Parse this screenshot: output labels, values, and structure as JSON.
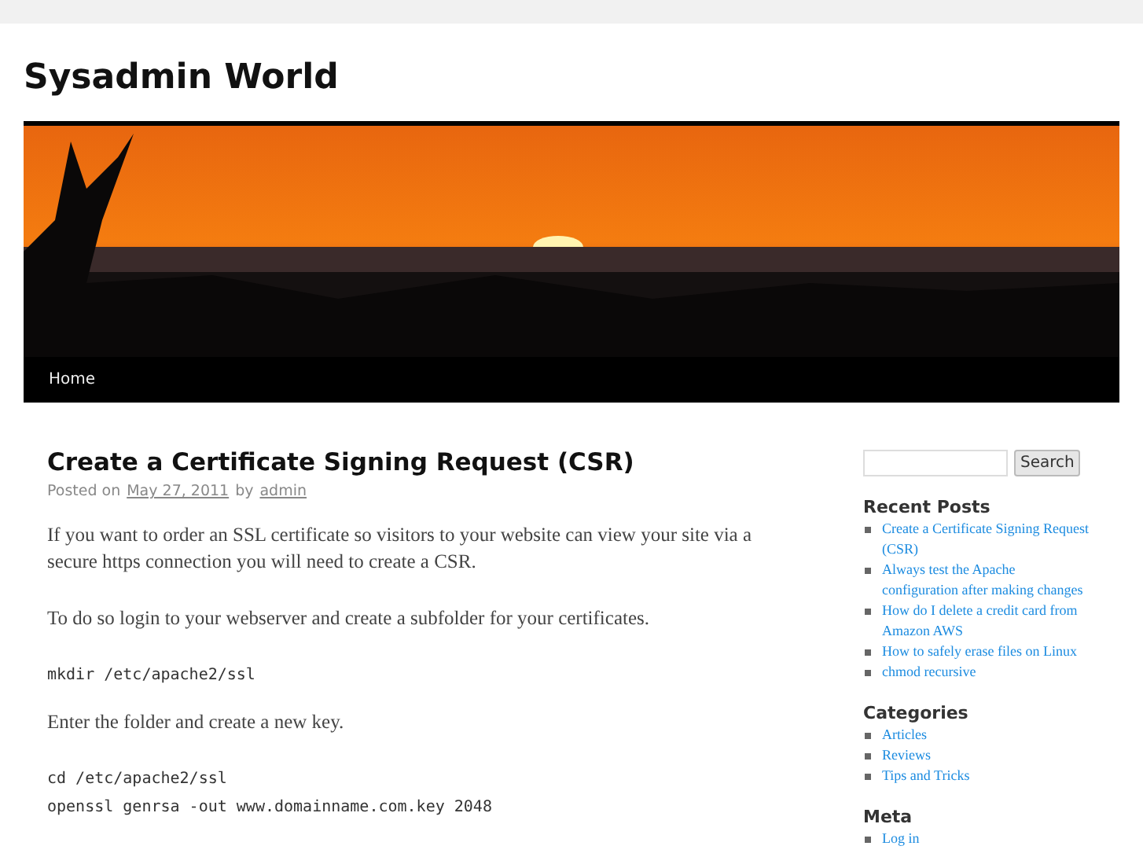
{
  "site": {
    "title": "Sysadmin World"
  },
  "nav": [
    {
      "label": "Home"
    }
  ],
  "post": {
    "title": "Create a Certificate Signing Request (CSR)",
    "meta": {
      "prefix": "Posted on",
      "date": "May 27, 2011",
      "by": "by",
      "author": "admin"
    },
    "blocks": [
      {
        "kind": "text",
        "lines": [
          "If you want to order an SSL certificate so visitors to your website can view your site via a secure https connection you will need to create a CSR."
        ]
      },
      {
        "kind": "text",
        "lines": [
          "To do so login to your webserver and create a subfolder for your certificates."
        ]
      },
      {
        "kind": "code",
        "lines": [
          "mkdir /etc/apache2/ssl"
        ]
      },
      {
        "kind": "text",
        "lines": [
          "Enter the folder and create a new key."
        ]
      },
      {
        "kind": "code",
        "lines": [
          "cd /etc/apache2/ssl",
          "openssl genrsa -out www.domainname.com.key 2048"
        ]
      }
    ]
  },
  "sidebar": {
    "search": {
      "button": "Search"
    },
    "widgets": [
      {
        "title": "Recent Posts",
        "items": [
          "Create a Certificate Signing Request (CSR)",
          "Always test the Apache configuration after making changes",
          "How do I delete a credit card from Amazon AWS",
          "How to safely erase files on Linux",
          "chmod recursive"
        ]
      },
      {
        "title": "Categories",
        "items": [
          "Articles",
          "Reviews",
          "Tips and Tricks"
        ]
      },
      {
        "title": "Meta",
        "items": [
          "Log in"
        ]
      }
    ]
  }
}
